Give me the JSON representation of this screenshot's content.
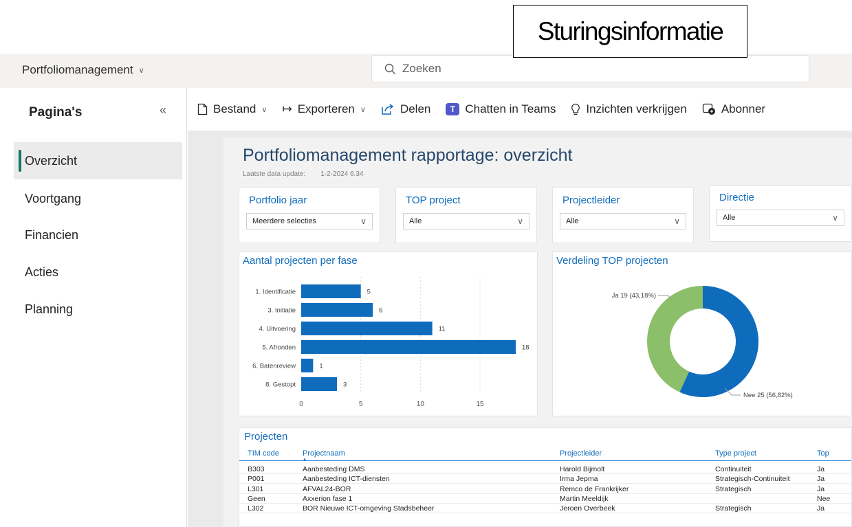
{
  "caption": "Sturingsinformatie",
  "appbar": {
    "workspace": "Portfoliomanagement",
    "search_placeholder": "Zoeken"
  },
  "leftpane": {
    "title": "Pagina's",
    "items": [
      {
        "label": "Overzicht",
        "active": true
      },
      {
        "label": "Voortgang",
        "active": false
      },
      {
        "label": "Financien",
        "active": false
      },
      {
        "label": "Acties",
        "active": false
      },
      {
        "label": "Planning",
        "active": false
      }
    ]
  },
  "toolbar": {
    "file": "Bestand",
    "export": "Exporteren",
    "share": "Delen",
    "teams": "Chatten in Teams",
    "insights": "Inzichten verkrijgen",
    "subscribe": "Abonner"
  },
  "report": {
    "title": "Portfoliomanagement rapportage: overzicht",
    "update_label": "Laatste data update:",
    "update_value": "1-2-2024 6.34"
  },
  "slicers": [
    {
      "label": "Portfolio jaar",
      "value": "Meerdere selecties"
    },
    {
      "label": "TOP project",
      "value": "Alle"
    },
    {
      "label": "Projectleider",
      "value": "Alle"
    },
    {
      "label": "Directie",
      "value": "Alle"
    }
  ],
  "bar_chart": {
    "title": "Aantal projecten per fase"
  },
  "donut_chart": {
    "title": "Verdeling TOP projecten"
  },
  "chart_data": [
    {
      "type": "bar",
      "orientation": "horizontal",
      "title": "Aantal projecten per fase",
      "categories": [
        "1. Identificatie",
        "3. Initiatie",
        "4. Uitvoering",
        "5. Afronden",
        "6. Batenreview",
        "8. Gestopt"
      ],
      "values": [
        5,
        6,
        11,
        18,
        1,
        3
      ],
      "xlim": [
        0,
        18
      ],
      "xticks": [
        0,
        5,
        10,
        15
      ],
      "data_labels": true,
      "color": "#0f6cbd"
    },
    {
      "type": "pie",
      "donut": true,
      "title": "Verdeling TOP projecten",
      "categories": [
        "Ja",
        "Nee"
      ],
      "values": [
        19,
        25
      ],
      "labels": [
        "Ja 19 (43,18%)",
        "Nee 25 (56,82%)"
      ],
      "colors": [
        "#8bbf69",
        "#0f6cbd"
      ]
    }
  ],
  "table": {
    "title": "Projecten",
    "columns": [
      "TIM code",
      "Projectnaam",
      "Projectleider",
      "Type project",
      "Top"
    ],
    "rows": [
      [
        "B303",
        "Aanbesteding DMS",
        "Harold Bijmolt",
        "Continuiteit",
        "Ja"
      ],
      [
        "P001",
        "Aanbesteding ICT-diensten",
        "Irma Jepma",
        "Strategisch-Continuiteit",
        "Ja"
      ],
      [
        "L301",
        "AFVAL24-BOR",
        "Remco de Frankrijker",
        "Strategisch",
        "Ja"
      ],
      [
        "Geen",
        "Axxerion fase 1",
        "Martin Meeldijk",
        "",
        "Nee"
      ],
      [
        "L302",
        "BOR Nieuwe ICT-omgeving Stadsbeheer",
        "Jeroen Overbeek",
        "Strategisch",
        "Ja"
      ]
    ]
  }
}
